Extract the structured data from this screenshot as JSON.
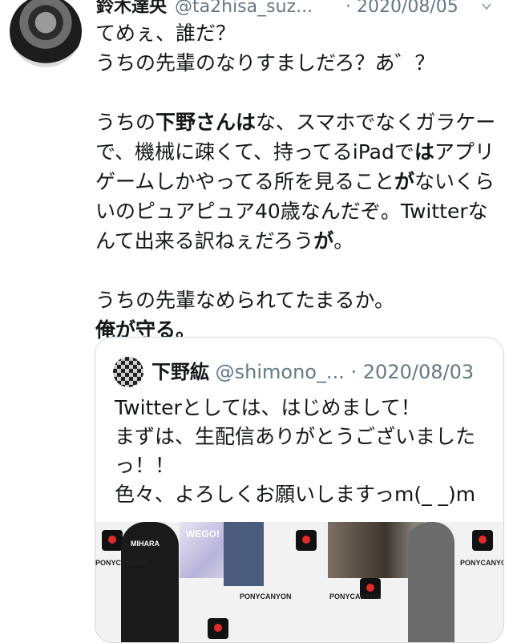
{
  "tweet": {
    "display_name": "鈴木達央",
    "handle": "@ta2hisa_suz...",
    "date": "· 2020/08/05",
    "lines": [
      [
        "てめぇ、誰だ？"
      ],
      [
        "うちの先輩のなりすましだろ？あ゛？"
      ],
      [],
      [
        "うちの",
        "下野さんは",
        "な、スマホでなくガラケー"
      ],
      [
        "で、機械に疎くて、持ってるiPadで",
        "は",
        "アプリ"
      ],
      [
        "ゲームしかやってる所を見ること",
        "が",
        "ないくら"
      ],
      [
        "いのピュアピュア40歳なんだぞ。Twitterな"
      ],
      [
        "んて出来る訳ねぇだろう",
        "が",
        "。"
      ],
      [],
      [
        "うちの先輩なめられてたまるか。"
      ],
      [
        "俺が守る。"
      ]
    ]
  },
  "quoted": {
    "display_name": "下野紘",
    "handle": "@shimono_...",
    "date": "· 2020/08/03",
    "lines": [
      "Twitterとしては、はじめまして！",
      "まずは、生配信ありがとうございました",
      "っ！！",
      "色々、よろしくお願いしますっm(_ _)m"
    ],
    "image_text": [
      "MIHARA",
      "WEGO!",
      "PONYCANYON",
      "PONYCANYON",
      "PONYCANYON",
      "PONYCANYON"
    ]
  }
}
